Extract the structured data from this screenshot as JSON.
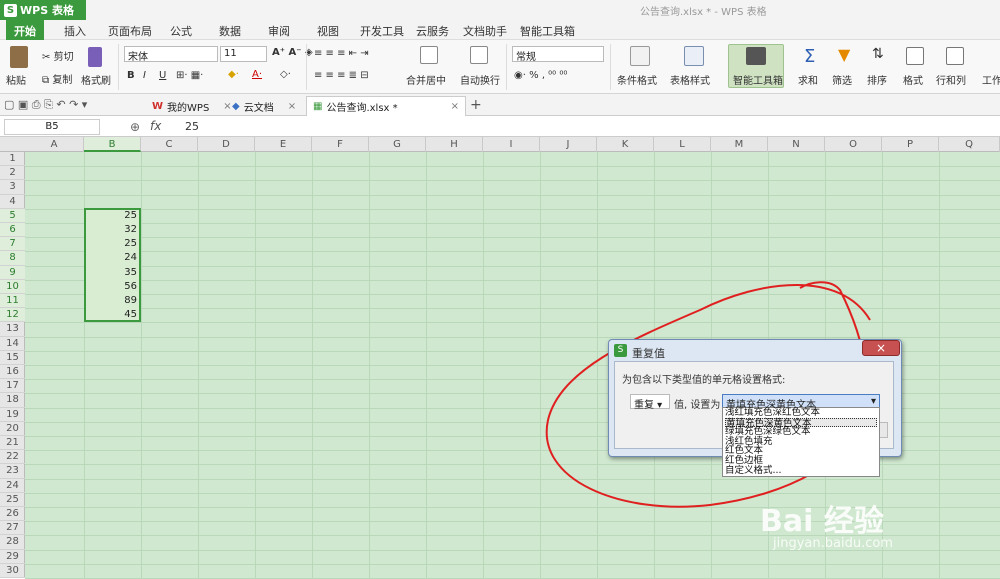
{
  "app": {
    "name": "WPS 表格",
    "logo": "S"
  },
  "window_title": "公告查询.xlsx * - WPS 表格",
  "menus": [
    "开始",
    "插入",
    "页面布局",
    "公式",
    "数据",
    "审阅",
    "视图",
    "开发工具",
    "云服务",
    "文档助手",
    "智能工具箱"
  ],
  "ribbon": {
    "paste": "粘贴",
    "cut": "剪切",
    "copy": "复制",
    "format_painter": "格式刷",
    "font_name": "宋体",
    "font_size": "11",
    "bold": "B",
    "italic": "I",
    "underline": "U",
    "merge_center": "合并居中",
    "wrap_text": "自动换行",
    "number_format": "常规",
    "percent": "%",
    "cond_format": "条件格式",
    "table_style": "表格样式",
    "smart_toolbox": "智能工具箱",
    "sum": "求和",
    "filter": "筛选",
    "sort": "排序",
    "format": "格式",
    "row_col": "行和列",
    "worksheet": "工作"
  },
  "tabs": [
    {
      "label": "我的WPS"
    },
    {
      "label": "云文档"
    },
    {
      "label": "公告查询.xlsx *"
    }
  ],
  "formula_bar": {
    "name_box": "B5",
    "fx": "fx",
    "value": "25"
  },
  "columns": [
    "A",
    "B",
    "C",
    "D",
    "E",
    "F",
    "G",
    "H",
    "I",
    "J",
    "K",
    "L",
    "M",
    "N",
    "O",
    "P",
    "Q"
  ],
  "rows": [
    "1",
    "2",
    "3",
    "4",
    "5",
    "6",
    "7",
    "8",
    "9",
    "10",
    "11",
    "12",
    "13",
    "14",
    "15",
    "16",
    "17",
    "18",
    "19",
    "20",
    "21",
    "22",
    "23",
    "24",
    "25",
    "26",
    "27",
    "28",
    "29",
    "30"
  ],
  "cells_b": [
    {
      "row": "5",
      "value": "25"
    },
    {
      "row": "6",
      "value": "32"
    },
    {
      "row": "7",
      "value": "25"
    },
    {
      "row": "8",
      "value": "24"
    },
    {
      "row": "9",
      "value": "35"
    },
    {
      "row": "10",
      "value": "56"
    },
    {
      "row": "11",
      "value": "89"
    },
    {
      "row": "12",
      "value": "45"
    }
  ],
  "dialog": {
    "title": "重复值",
    "prompt": "为包含以下类型值的单元格设置格式:",
    "type_select": "重复",
    "mid_label": "值, 设置为",
    "format_select": "黄填充色深黄色文本",
    "options": [
      "浅红填充色深红色文本",
      "黄填充色深黄色文本",
      "绿填充色深绿色文本",
      "浅红色填充",
      "红色文本",
      "红色边框",
      "自定义格式..."
    ]
  },
  "watermark": {
    "brand": "Bai 经验",
    "url": "jingyan.baidu.com"
  },
  "colors": {
    "accent": "#3b9a3d",
    "grid_bg": "#cfe8cf",
    "annotation": "#e02020"
  }
}
